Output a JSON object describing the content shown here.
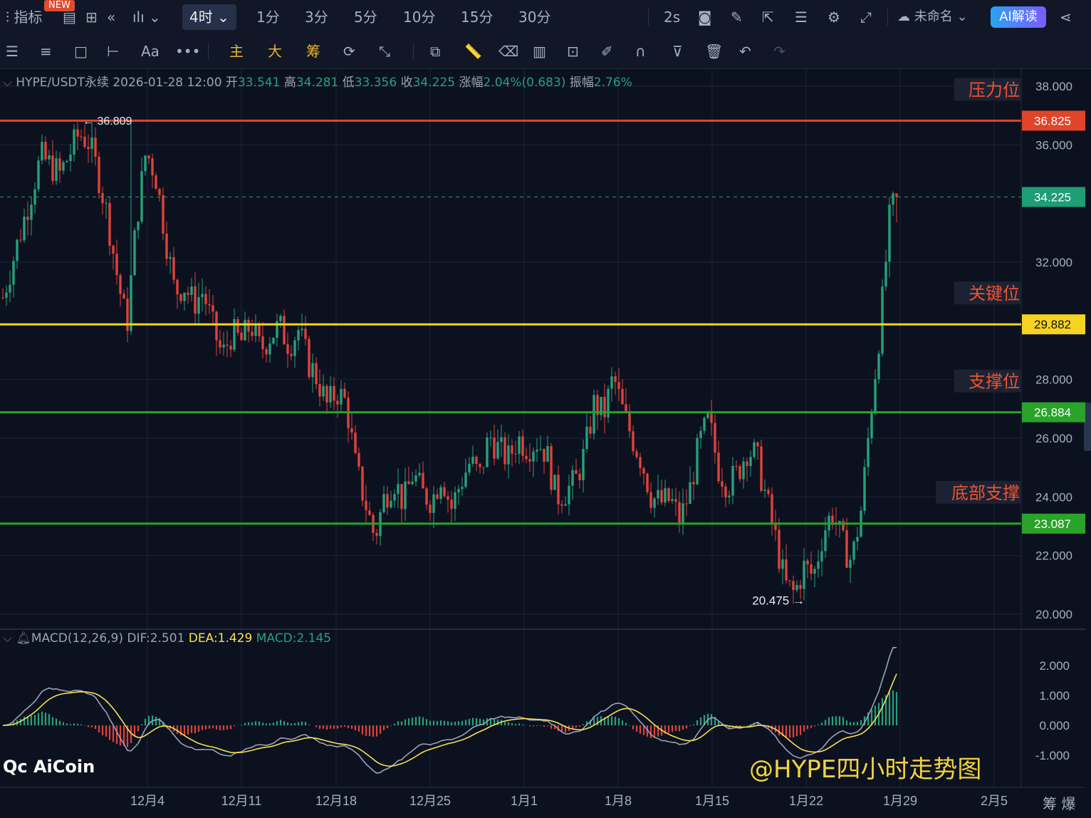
{
  "toolbar": {
    "indicator_label": "指标",
    "new_badge": "NEW",
    "timeframes": [
      "4时",
      "1分",
      "3分",
      "5分",
      "10分",
      "15分",
      "30分"
    ],
    "active_timeframe": "4时",
    "refresh": "2s",
    "layout_name": "未命名",
    "ai_button": "AI解读"
  },
  "toolbar2": {
    "tools_text": [
      "Aa",
      "主",
      "大",
      "筹"
    ]
  },
  "symbol_info": {
    "pair": "HYPE/USDT永续",
    "datetime": "2026-01-28 12:00",
    "open_label": "开",
    "open": "33.541",
    "high_label": "高",
    "high": "34.281",
    "low_label": "低",
    "low": "33.356",
    "close_label": "收",
    "close": "34.225",
    "change_label": "涨幅",
    "change": "2.04%(0.683)",
    "amp_label": "振幅",
    "amp": "2.76%"
  },
  "macd_info": {
    "name": "MACD(12,26,9)",
    "dif": "DIF:2.501",
    "dea": "DEA:1.429",
    "macd": "MACD:2.145"
  },
  "watermark": "@HYPE四小时走势图",
  "logo": "AiCoin",
  "bottom_right": [
    "筹",
    "爆"
  ],
  "colors": {
    "up": "#26a17b",
    "down": "#e0423a",
    "resistance": "#e0452a",
    "key": "#f5d320",
    "support": "#29a329",
    "dea": "#f5e050",
    "dif": "#9aa3b5"
  },
  "chart_data": {
    "type": "candlestick",
    "y_ticks": [
      "38.000",
      "36.000",
      "32.000",
      "28.000",
      "26.000",
      "24.000",
      "22.000",
      "20.000"
    ],
    "ylim": [
      19.5,
      38.5
    ],
    "x_ticks": [
      "12月4",
      "12月11",
      "12月18",
      "12月25",
      "1月1",
      "1月8",
      "1月15",
      "1月22",
      "1月29",
      "2月5"
    ],
    "levels": [
      {
        "label": "压力位",
        "price": "36.825",
        "value": 36.825,
        "color": "#e0452a"
      },
      {
        "label": "关键位",
        "price": "29.882",
        "value": 29.882,
        "color": "#f5d320"
      },
      {
        "label": "支撑位",
        "price": "26.884",
        "value": 26.884,
        "color": "#29a329"
      },
      {
        "label": "底部支撑",
        "price": "23.087",
        "value": 23.087,
        "color": "#29a329"
      }
    ],
    "last_price": {
      "label": "34.225",
      "value": 34.225
    },
    "high_marker": {
      "label": "36.809",
      "value": 36.809
    },
    "low_marker": {
      "label": "20.475",
      "value": 20.475
    },
    "path_close": [
      [
        0,
        30.8
      ],
      [
        2,
        33.2
      ],
      [
        4,
        35.6
      ],
      [
        6,
        35.0
      ],
      [
        8,
        36.4
      ],
      [
        9,
        36.1
      ],
      [
        10,
        35.0
      ],
      [
        11,
        33.5
      ],
      [
        12,
        31.5
      ],
      [
        13,
        29.8
      ],
      [
        14,
        33.4
      ],
      [
        15,
        35.8
      ],
      [
        16,
        35.0
      ],
      [
        17,
        33.0
      ],
      [
        18,
        31.0
      ],
      [
        19,
        31.2
      ],
      [
        20,
        30.6
      ],
      [
        21,
        31.0
      ],
      [
        22,
        29.8
      ],
      [
        23,
        28.8
      ],
      [
        24,
        29.6
      ],
      [
        25,
        29.3
      ],
      [
        26,
        29.9
      ],
      [
        27,
        29.0
      ],
      [
        28,
        29.5
      ],
      [
        29,
        29.8
      ],
      [
        30,
        29.2
      ],
      [
        31,
        29.7
      ],
      [
        32,
        28.6
      ],
      [
        33,
        28.0
      ],
      [
        34,
        27.1
      ],
      [
        35,
        27.6
      ],
      [
        36,
        27.2
      ],
      [
        37,
        25.0
      ],
      [
        38,
        23.8
      ],
      [
        39,
        22.6
      ],
      [
        40,
        24.0
      ],
      [
        41,
        24.6
      ],
      [
        42,
        23.8
      ],
      [
        43,
        24.8
      ],
      [
        44,
        24.1
      ],
      [
        45,
        23.9
      ],
      [
        46,
        24.8
      ],
      [
        47,
        23.6
      ],
      [
        48,
        24.5
      ],
      [
        49,
        25.2
      ],
      [
        50,
        24.7
      ],
      [
        51,
        26.1
      ],
      [
        52,
        25.6
      ],
      [
        53,
        25.3
      ],
      [
        54,
        26.0
      ],
      [
        55,
        25.7
      ],
      [
        56,
        25.9
      ],
      [
        57,
        25.5
      ],
      [
        58,
        24.0
      ],
      [
        59,
        24.2
      ],
      [
        60,
        24.5
      ],
      [
        61,
        25.5
      ],
      [
        62,
        27.2
      ],
      [
        63,
        26.8
      ],
      [
        64,
        28.1
      ],
      [
        65,
        26.9
      ],
      [
        66,
        26.0
      ],
      [
        67,
        25.2
      ],
      [
        68,
        24.0
      ],
      [
        69,
        23.8
      ],
      [
        70,
        23.9
      ],
      [
        71,
        23.2
      ],
      [
        72,
        24.2
      ],
      [
        73,
        25.8
      ],
      [
        74,
        26.6
      ],
      [
        75,
        25.0
      ],
      [
        76,
        24.4
      ],
      [
        77,
        24.8
      ],
      [
        78,
        25.6
      ],
      [
        79,
        25.4
      ],
      [
        80,
        24.0
      ],
      [
        81,
        22.6
      ],
      [
        82,
        21.0
      ],
      [
        83,
        20.7
      ],
      [
        84,
        21.6
      ],
      [
        85,
        21.3
      ],
      [
        86,
        22.8
      ],
      [
        87,
        23.5
      ],
      [
        88,
        22.4
      ],
      [
        89,
        21.8
      ],
      [
        90,
        23.6
      ],
      [
        91,
        26.9
      ],
      [
        92,
        29.9
      ],
      [
        93,
        33.6
      ],
      [
        93.7,
        34.225
      ]
    ]
  }
}
